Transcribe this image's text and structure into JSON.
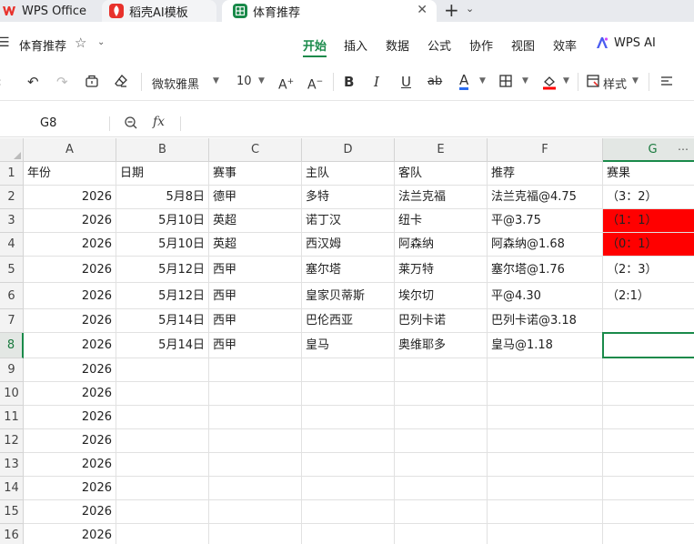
{
  "tabs": {
    "wps": "WPS Office",
    "daoke": "稻壳AI模板",
    "sheet": "体育推荐"
  },
  "menubar": {
    "doc_title": "体育推荐",
    "items": [
      "开始",
      "插入",
      "数据",
      "公式",
      "协作",
      "视图",
      "效率"
    ],
    "ai": "WPS AI"
  },
  "toolbar": {
    "font_name": "微软雅黑",
    "font_size": "10",
    "style_label": "样式"
  },
  "formula_bar": {
    "cell_ref": "G8",
    "fx": "fx",
    "value": ""
  },
  "colors": {
    "accent": "#1a8a4a",
    "highlight_red": "#ff0000"
  },
  "sheet": {
    "columns": [
      "A",
      "B",
      "C",
      "D",
      "E",
      "F",
      "G"
    ],
    "selected_column": "G",
    "selected_row": 8,
    "row_numbers": [
      1,
      2,
      3,
      4,
      5,
      6,
      7,
      8,
      9,
      10,
      11,
      12,
      13,
      14,
      15,
      16
    ],
    "rows": [
      [
        "年份",
        "日期",
        "赛事",
        "主队",
        "客队",
        "推荐",
        "赛果"
      ],
      [
        "2026",
        "5月8日",
        "德甲",
        "多特",
        "法兰克福",
        "法兰克福@4.75",
        "（3：2）"
      ],
      [
        "2026",
        "5月10日",
        "英超",
        "诺丁汉",
        "纽卡",
        "平@3.75",
        "（1：1）"
      ],
      [
        "2026",
        "5月10日",
        "英超",
        "西汉姆",
        "阿森纳",
        "阿森纳@1.68",
        "（0：1）"
      ],
      [
        "2026",
        "5月12日",
        "西甲",
        "塞尔塔",
        "莱万特",
        "塞尔塔@1.76",
        "（2：3）"
      ],
      [
        "2026",
        "5月12日",
        "西甲",
        "皇家贝蒂斯",
        "埃尔切",
        "平@4.30",
        "（2:1）"
      ],
      [
        "2026",
        "5月14日",
        "西甲",
        "巴伦西亚",
        "巴列卡诺",
        "巴列卡诺@3.18",
        ""
      ],
      [
        "2026",
        "5月14日",
        "西甲",
        "皇马",
        "奥维耶多",
        "皇马@1.18",
        ""
      ],
      [
        "2026",
        "",
        "",
        "",
        "",
        "",
        ""
      ],
      [
        "2026",
        "",
        "",
        "",
        "",
        "",
        ""
      ],
      [
        "2026",
        "",
        "",
        "",
        "",
        "",
        ""
      ],
      [
        "2026",
        "",
        "",
        "",
        "",
        "",
        ""
      ],
      [
        "2026",
        "",
        "",
        "",
        "",
        "",
        ""
      ],
      [
        "2026",
        "",
        "",
        "",
        "",
        "",
        ""
      ],
      [
        "2026",
        "",
        "",
        "",
        "",
        "",
        ""
      ],
      [
        "2026",
        "",
        "",
        "",
        "",
        "",
        ""
      ]
    ],
    "highlighted_result_rows": [
      3,
      4
    ]
  }
}
